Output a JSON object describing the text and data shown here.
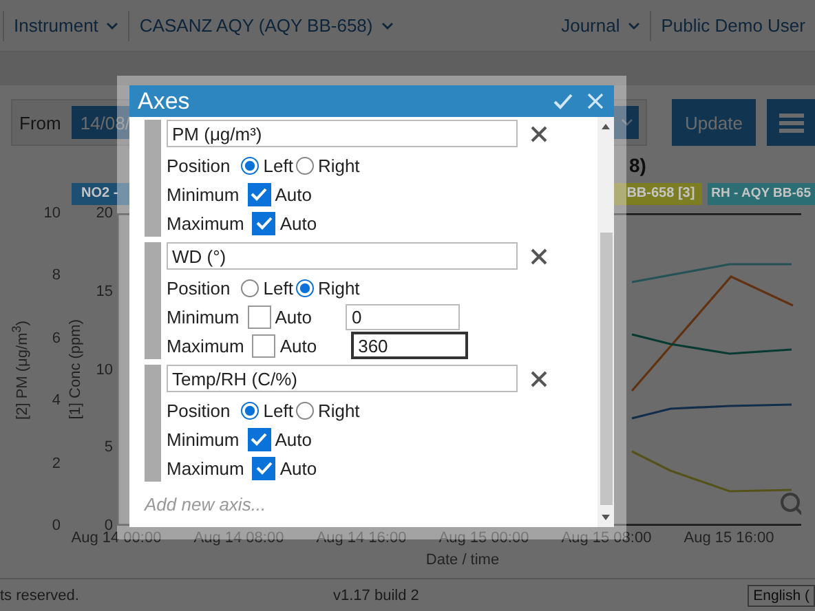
{
  "nav": {
    "left_menus": [
      {
        "label": "Instrument",
        "dropdown": true
      },
      {
        "label": "CASANZ AQY (AQY BB-658)",
        "dropdown": true
      }
    ],
    "right_menus": [
      {
        "label": "Journal",
        "dropdown": true
      },
      {
        "label": "Public Demo User",
        "dropdown": false
      }
    ]
  },
  "toolbar": {
    "from_label": "From",
    "from_value": "14/08/",
    "update_button": "Update"
  },
  "chart": {
    "title": "8)",
    "legend": [
      {
        "label": "NO2 -",
        "color": "#1d4f73"
      },
      {
        "label": "BB-658 [3]",
        "color": "#7d7d22"
      },
      {
        "label": "RH - AQY BB-65",
        "color": "#2b6f74"
      }
    ],
    "left_axis": {
      "label": "[2] PM (μg/m$^{3}$)",
      "ticks": [
        "10",
        "8",
        "6",
        "4",
        "2",
        "0"
      ]
    },
    "second_axis": {
      "label": "[1] Conc (ppm)",
      "ticks": [
        "20",
        "15",
        "10",
        "5",
        "0"
      ]
    },
    "x_ticks": [
      "Aug 14 00:00",
      "Aug 14 08:00",
      "Aug 14 16:00",
      "Aug 15 00:00",
      "Aug 15 08:00",
      "Aug 15 16:00"
    ],
    "xlabel": "Date / time"
  },
  "footer": {
    "copyright": "ts reserved.",
    "version": "v1.17 build 2",
    "language": "English ("
  },
  "dialog": {
    "title": "Axes",
    "add_axis_placeholder": "Add new axis...",
    "axes": [
      {
        "name": "PM (μg/m³)",
        "position_label": "Position",
        "positions": [
          {
            "label": "Left",
            "selected": true
          },
          {
            "label": "Right",
            "selected": false
          }
        ],
        "limits": [
          {
            "label": "Minimum",
            "auto_label": "Auto",
            "checked": true
          },
          {
            "label": "Maximum",
            "auto_label": "Auto",
            "checked": true
          }
        ]
      },
      {
        "name": "WD (°)",
        "position_label": "Position",
        "positions": [
          {
            "label": "Left",
            "selected": false
          },
          {
            "label": "Right",
            "selected": true
          }
        ],
        "limits": [
          {
            "label": "Minimum",
            "auto_label": "Auto",
            "checked": false,
            "value": "0",
            "focused": false
          },
          {
            "label": "Maximum",
            "auto_label": "Auto",
            "checked": false,
            "value": "360",
            "focused": true
          }
        ]
      },
      {
        "name": "Temp/RH (C/%)",
        "position_label": "Position",
        "positions": [
          {
            "label": "Left",
            "selected": true
          },
          {
            "label": "Right",
            "selected": false
          }
        ],
        "limits": [
          {
            "label": "Minimum",
            "auto_label": "Auto",
            "checked": true
          },
          {
            "label": "Maximum",
            "auto_label": "Auto",
            "checked": true
          }
        ]
      }
    ]
  }
}
